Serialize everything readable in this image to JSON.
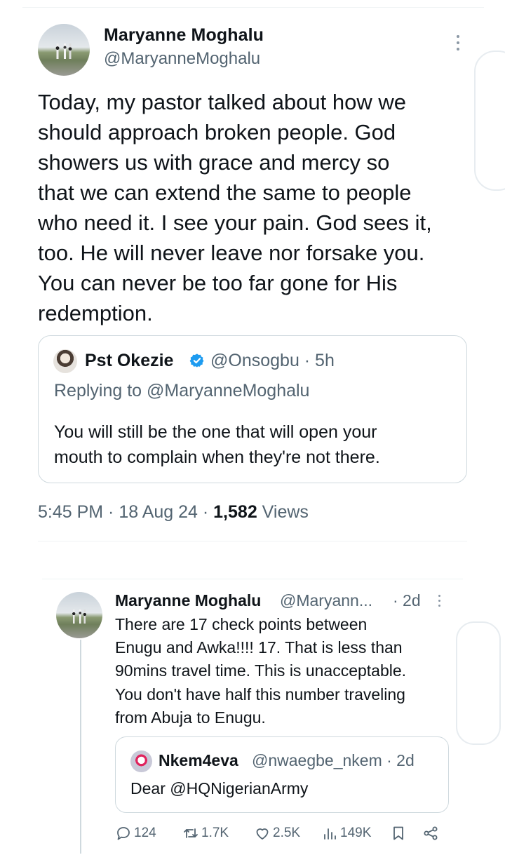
{
  "main_tweet": {
    "author_name": "Maryanne Moghalu",
    "author_handle": "@MaryanneMoghalu",
    "text_lines": [
      "Today, my pastor talked about how we",
      "should approach broken people. God",
      "showers us with grace and mercy so",
      "that we can extend the same to people",
      "who need it. I see your pain. God sees it,",
      "too. He will never leave nor forsake you.",
      "You can never be too far gone for His",
      "redemption."
    ],
    "quoted": {
      "author_name": "Pst Okezie",
      "author_handle": "@Onsogbu · 5h",
      "replying_to": "Replying to @MaryanneMoghalu",
      "text_lines": [
        "You will still be the one that will open your",
        "mouth to complain when they're not there."
      ]
    },
    "meta": {
      "time_date": "5:45 PM · 18 Aug 24 · ",
      "views_count": "1,582",
      "views_label": " Views"
    }
  },
  "thread_tweet": {
    "author_name": "Maryanne Moghalu",
    "author_handle": "@Maryann...",
    "time": "· 2d",
    "text_lines": [
      "There are 17 check points between",
      "Enugu and Awka!!!! 17. That is less than",
      "90mins travel time. This is unacceptable.",
      "You don't have half this number traveling",
      "from Abuja to Enugu."
    ],
    "quoted": {
      "author_name": "Nkem4eva",
      "author_handle": "@nwaegbe_nkem · 2d",
      "text": "Dear @HQNigerianArmy"
    },
    "actions": {
      "replies": "124",
      "reposts": "1.7K",
      "likes": "2.5K",
      "views": "149K"
    }
  },
  "icons": {
    "verified": "verified-badge-icon",
    "reply": "reply-icon",
    "repost": "repost-icon",
    "like": "heart-icon",
    "views": "views-icon",
    "bookmark": "bookmark-icon",
    "share": "share-icon",
    "more": "more-icon"
  },
  "colors": {
    "text": "#0f1419",
    "muted": "#536471",
    "verified": "#1d9bf0",
    "border": "#cfd9de"
  }
}
